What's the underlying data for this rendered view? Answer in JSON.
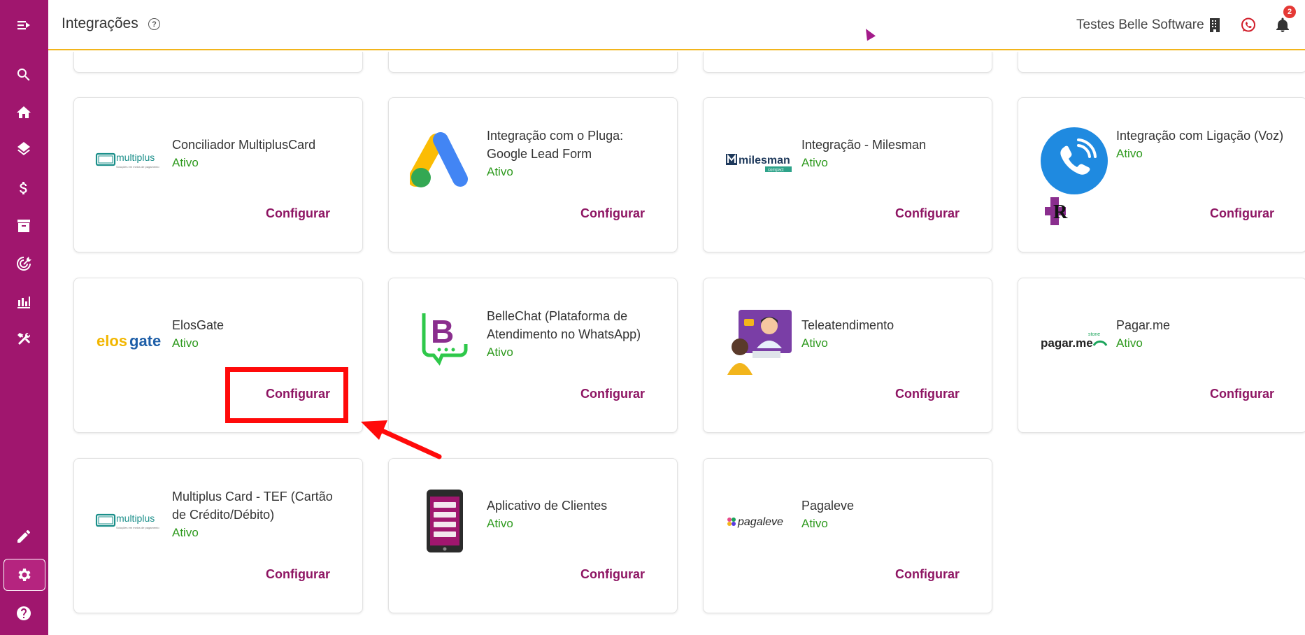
{
  "header": {
    "title": "Integrações",
    "help_icon": "question-circle-icon",
    "company": "Testes Belle Software",
    "notification_count": "2"
  },
  "sidebar": {
    "items": [
      {
        "icon": "menu-collapse-icon"
      },
      {
        "icon": "search-icon"
      },
      {
        "icon": "home-icon"
      },
      {
        "icon": "layers-icon"
      },
      {
        "icon": "dollar-icon"
      },
      {
        "icon": "archive-icon"
      },
      {
        "icon": "target-icon"
      },
      {
        "icon": "chart-icon"
      },
      {
        "icon": "tools-icon"
      },
      {
        "icon": "pencil-icon"
      },
      {
        "icon": "gear-icon"
      },
      {
        "icon": "help-icon"
      }
    ]
  },
  "cards": [
    {
      "title": "Conciliador MultiplusCard",
      "status": "Ativo",
      "action": "Configurar",
      "logo": "multiplus-logo"
    },
    {
      "title": "Integração com o Pluga: Google Lead Form",
      "status": "Ativo",
      "action": "Configurar",
      "logo": "google-ads-logo"
    },
    {
      "title": "Integração - Milesman",
      "status": "Ativo",
      "action": "Configurar",
      "logo": "milesman-logo"
    },
    {
      "title": "Integração com Ligação (Voz)",
      "status": "Ativo",
      "action": "Configurar",
      "logo": "phone-call-logo"
    },
    {
      "title": "ElosGate",
      "status": "Ativo",
      "action": "Configurar",
      "logo": "elosgate-logo"
    },
    {
      "title": "BelleChat (Plataforma de Atendimento no WhatsApp)",
      "status": "Ativo",
      "action": "Configurar",
      "logo": "bellechat-logo"
    },
    {
      "title": "Teleatendimento",
      "status": "Ativo",
      "action": "Configurar",
      "logo": "teleatendimento-logo"
    },
    {
      "title": "Pagar.me",
      "status": "Ativo",
      "action": "Configurar",
      "logo": "pagarme-logo"
    },
    {
      "title": "Multiplus Card - TEF (Cartão de Crédito/Débito)",
      "status": "Ativo",
      "action": "Configurar",
      "logo": "multiplus-logo"
    },
    {
      "title": "Aplicativo de Clientes",
      "status": "Ativo",
      "action": "Configurar",
      "logo": "mobile-app-logo"
    },
    {
      "title": "Pagaleve",
      "status": "Ativo",
      "action": "Configurar",
      "logo": "pagaleve-logo"
    }
  ],
  "logos": {
    "multiplus": "multiplus",
    "multiplus_sub": "Soluções em meios de pagamento",
    "milesman": "milesman",
    "milesman_sub": "compact",
    "elos": "elos",
    "gate": "gate",
    "bellechat": "B",
    "pagarme_stone": "stone",
    "pagarme": "pagar.me",
    "pagaleve": "pagaleve"
  },
  "colors": {
    "sidebar": "#a0166e",
    "accent": "#8e1563",
    "status": "#2e9a1e",
    "header_border": "#f2b51c",
    "annotation": "#ff0a0a"
  }
}
